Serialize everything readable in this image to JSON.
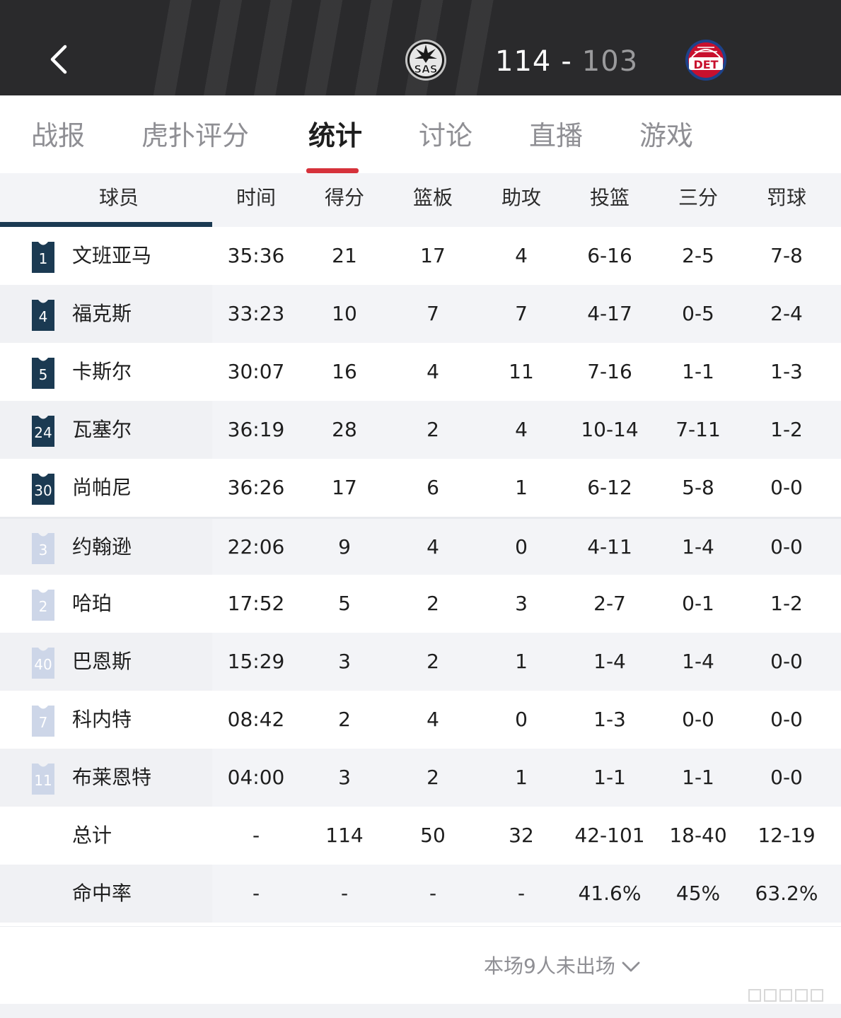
{
  "header": {
    "home_score": "114",
    "separator": "-",
    "away_score": "103",
    "home_team_abbr": "SAS",
    "away_team_abbr": "DET"
  },
  "tabs": [
    {
      "label": "战报"
    },
    {
      "label": "虎扑评分"
    },
    {
      "label": "统计",
      "active": true
    },
    {
      "label": "讨论"
    },
    {
      "label": "直播"
    },
    {
      "label": "游戏"
    }
  ],
  "columns": [
    "球员",
    "时间",
    "得分",
    "篮板",
    "助攻",
    "投篮",
    "三分",
    "罚球"
  ],
  "starters": [
    {
      "number": "1",
      "name": "文班亚马",
      "time": "35:36",
      "pts": "21",
      "reb": "17",
      "ast": "4",
      "fg": "6-16",
      "tp": "2-5",
      "ft": "7-8"
    },
    {
      "number": "4",
      "name": "福克斯",
      "time": "33:23",
      "pts": "10",
      "reb": "7",
      "ast": "7",
      "fg": "4-17",
      "tp": "0-5",
      "ft": "2-4"
    },
    {
      "number": "5",
      "name": "卡斯尔",
      "time": "30:07",
      "pts": "16",
      "reb": "4",
      "ast": "11",
      "fg": "7-16",
      "tp": "1-1",
      "ft": "1-3"
    },
    {
      "number": "24",
      "name": "瓦塞尔",
      "time": "36:19",
      "pts": "28",
      "reb": "2",
      "ast": "4",
      "fg": "10-14",
      "tp": "7-11",
      "ft": "1-2"
    },
    {
      "number": "30",
      "name": "尚帕尼",
      "time": "36:26",
      "pts": "17",
      "reb": "6",
      "ast": "1",
      "fg": "6-12",
      "tp": "5-8",
      "ft": "0-0"
    }
  ],
  "bench": [
    {
      "number": "3",
      "name": "约翰逊",
      "time": "22:06",
      "pts": "9",
      "reb": "4",
      "ast": "0",
      "fg": "4-11",
      "tp": "1-4",
      "ft": "0-0"
    },
    {
      "number": "2",
      "name": "哈珀",
      "time": "17:52",
      "pts": "5",
      "reb": "2",
      "ast": "3",
      "fg": "2-7",
      "tp": "0-1",
      "ft": "1-2"
    },
    {
      "number": "40",
      "name": "巴恩斯",
      "time": "15:29",
      "pts": "3",
      "reb": "2",
      "ast": "1",
      "fg": "1-4",
      "tp": "1-4",
      "ft": "0-0"
    },
    {
      "number": "7",
      "name": "科内特",
      "time": "08:42",
      "pts": "2",
      "reb": "4",
      "ast": "0",
      "fg": "1-3",
      "tp": "0-0",
      "ft": "0-0"
    },
    {
      "number": "11",
      "name": "布莱恩特",
      "time": "04:00",
      "pts": "3",
      "reb": "2",
      "ast": "1",
      "fg": "1-1",
      "tp": "1-1",
      "ft": "0-0"
    }
  ],
  "totals": {
    "name": "总计",
    "time": "-",
    "pts": "114",
    "reb": "50",
    "ast": "32",
    "fg": "42-101",
    "tp": "18-40",
    "ft": "12-19"
  },
  "pct": {
    "name": "命中率",
    "time": "-",
    "pts": "-",
    "reb": "-",
    "ast": "-",
    "fg": "41.6%",
    "tp": "45%",
    "ft": "63.2%"
  },
  "footer": {
    "dnp_text": "本场9人未出场"
  },
  "colors": {
    "header_bg": "#2a2a2c",
    "accent_red": "#d6323b",
    "starter_jersey": "#1b3a52",
    "bench_jersey": "#cdd6e8"
  }
}
